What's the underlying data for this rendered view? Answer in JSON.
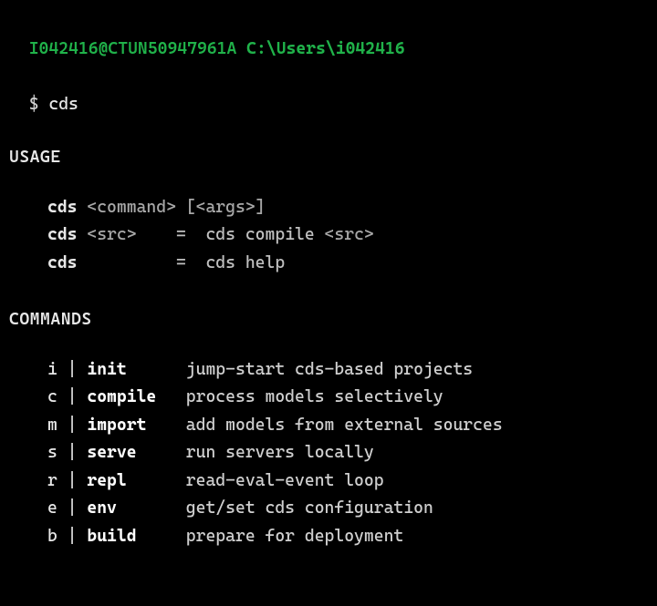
{
  "prompt": {
    "user_host": "I042416@CTUN50947961A",
    "cwd": "C:\\Users\\i042416",
    "symbol": "$",
    "command": "cds"
  },
  "sections": {
    "usage": "USAGE",
    "commands": "COMMANDS"
  },
  "usage": [
    {
      "left": "cds",
      "mid": "<command>",
      "midargs": "[<args>]",
      "eq": "",
      "right": ""
    },
    {
      "left": "cds",
      "mid": "<src>",
      "midargs": "",
      "eq": "=",
      "right": "cds compile ",
      "rightarg": "<src>"
    },
    {
      "left": "cds",
      "mid": "",
      "midargs": "",
      "eq": "=",
      "right": "cds help",
      "rightarg": ""
    }
  ],
  "commands": [
    {
      "alias": "i",
      "name": "init",
      "desc": "jump-start cds-based projects"
    },
    {
      "alias": "c",
      "name": "compile",
      "desc": "process models selectively"
    },
    {
      "alias": "m",
      "name": "import",
      "desc": "add models from external sources"
    },
    {
      "alias": "s",
      "name": "serve",
      "desc": "run servers locally"
    },
    {
      "alias": "r",
      "name": "repl",
      "desc": "read-eval-event loop"
    },
    {
      "alias": "e",
      "name": "env",
      "desc": "get/set cds configuration"
    },
    {
      "alias": "b",
      "name": "build",
      "desc": "prepare for deployment"
    }
  ]
}
